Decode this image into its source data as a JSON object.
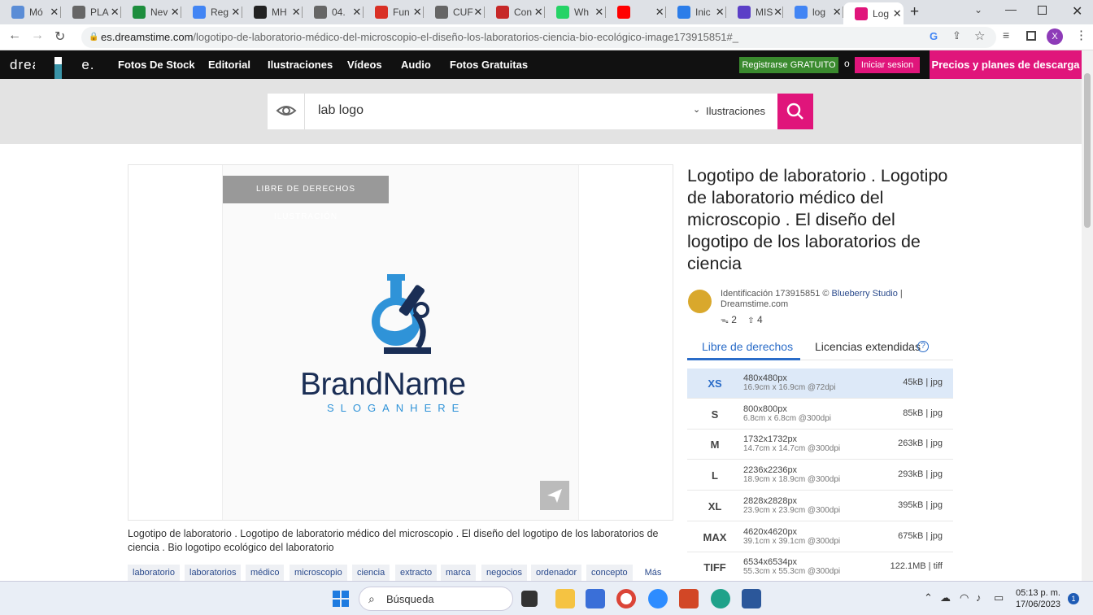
{
  "browser": {
    "tabs": [
      {
        "label": "Mó",
        "color": "#5b8dd6"
      },
      {
        "label": "PLA",
        "color": "#666666"
      },
      {
        "label": "Nev",
        "color": "#1e8e3e"
      },
      {
        "label": "Reg",
        "color": "#4285f4"
      },
      {
        "label": "MH",
        "color": "#222222"
      },
      {
        "label": "04.",
        "color": "#666666"
      },
      {
        "label": "Fun",
        "color": "#d93025"
      },
      {
        "label": "CUF",
        "color": "#666666"
      },
      {
        "label": "Con",
        "color": "#c62828"
      },
      {
        "label": "Wh",
        "color": "#25d366"
      },
      {
        "label": "",
        "color": "#ff0000"
      },
      {
        "label": "Inic",
        "color": "#2b7de9"
      },
      {
        "label": "MIS",
        "color": "#5b3fc7"
      },
      {
        "label": "log",
        "color": "#4285f4"
      },
      {
        "label": "Log",
        "color": "#e0157b"
      }
    ],
    "url_host": "es.dreamstime.com",
    "url_path": "/logotipo-de-laboratorio-médico-del-microscopio-el-diseño-los-laboratorios-ciencia-bio-ecológico-image173915851#_",
    "profile_initial": "X"
  },
  "site": {
    "logo": "dreamstime.",
    "nav": [
      "Fotos De Stock",
      "Editorial",
      "Ilustraciones",
      "Vídeos",
      "Audio",
      "Fotos Gratuitas"
    ],
    "register_label": "Registrarse GRATUITO",
    "or_label": "o",
    "login_label": "Iniciar sesion",
    "prices_label": "Precios y planes de descarga"
  },
  "search": {
    "query": "lab logo",
    "type": "Ilustraciones"
  },
  "image": {
    "badge": "LIBRE DE DERECHOS ILUSTRACIÓN",
    "brand_text": "BrandName",
    "slogan_text": "SLOGANHERE",
    "description": "Logotipo de laboratorio . Logotipo de laboratorio médico del microscopio . El diseño del logotipo de los laboratorios de ciencia . Bio logotipo ecológico del laboratorio",
    "keywords": [
      "laboratorio",
      "laboratorios",
      "médico",
      "microscopio",
      "ciencia",
      "extracto",
      "marca",
      "negocios",
      "ordenador",
      "concepto"
    ],
    "more_label": "Más"
  },
  "detail": {
    "title": "Logotipo de laboratorio . Logotipo de laboratorio médico del microscopio . El diseño del logotipo de los laboratorios de ciencia",
    "id_text": "Identificación 173915851 ©",
    "author": "Blueberry Studio",
    "source": "Dreamstime.com",
    "views": "2",
    "downloads": "4",
    "tab_royalty": "Libre de derechos",
    "tab_extended": "Licencias extendidas",
    "sizes": [
      {
        "code": "XS",
        "px": "480x480px",
        "cm": "16.9cm x 16.9cm @72dpi",
        "file": "45kB | jpg",
        "selected": true
      },
      {
        "code": "S",
        "px": "800x800px",
        "cm": "6.8cm x 6.8cm @300dpi",
        "file": "85kB | jpg",
        "selected": false
      },
      {
        "code": "M",
        "px": "1732x1732px",
        "cm": "14.7cm x 14.7cm @300dpi",
        "file": "263kB | jpg",
        "selected": false
      },
      {
        "code": "L",
        "px": "2236x2236px",
        "cm": "18.9cm x 18.9cm @300dpi",
        "file": "293kB | jpg",
        "selected": false
      },
      {
        "code": "XL",
        "px": "2828x2828px",
        "cm": "23.9cm x 23.9cm @300dpi",
        "file": "395kB | jpg",
        "selected": false
      },
      {
        "code": "MAX",
        "px": "4620x4620px",
        "cm": "39.1cm x 39.1cm @300dpi",
        "file": "675kB | jpg",
        "selected": false
      },
      {
        "code": "TIFF",
        "px": "6534x6534px",
        "cm": "55.3cm x 55.3cm @300dpi",
        "file": "122.1MB | tiff",
        "selected": false
      }
    ]
  },
  "taskbar": {
    "search_label": "Búsqueda",
    "time": "05:13 p. m.",
    "date": "17/06/2023",
    "notif_count": "1"
  },
  "colors": {
    "accent": "#e0157b",
    "register": "#3a8a2e",
    "link": "#2a4a8c",
    "logo_blue": "#2f93d8",
    "logo_navy": "#1a2e55"
  }
}
